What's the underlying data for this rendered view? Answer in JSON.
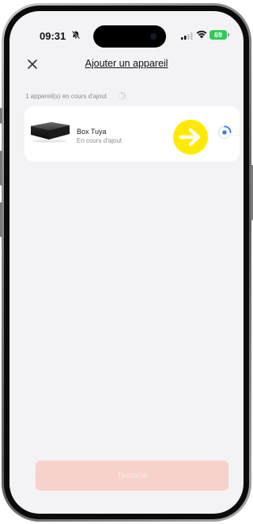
{
  "status_bar": {
    "time": "09:31",
    "battery": "69"
  },
  "header": {
    "title": "Ajouter un appareil",
    "close_icon": "close-icon"
  },
  "section": {
    "count_label": "1 appareil(s) en cours d'ajout"
  },
  "device": {
    "name": "Box Tuya",
    "status": "En cours d'ajout"
  },
  "colors": {
    "background": "#f3f3f6",
    "card": "#ffffff",
    "annotation": "#ffea00",
    "spinner": "#2f7bf5",
    "button_disabled": "#f7d2cb"
  },
  "footer": {
    "finish_label": "Terminé"
  }
}
